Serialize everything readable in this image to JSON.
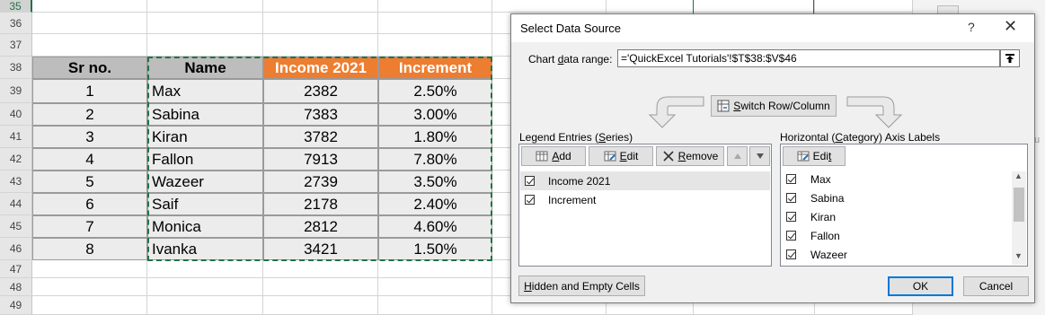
{
  "sheet": {
    "rows": [
      "35",
      "36",
      "37",
      "38",
      "39",
      "40",
      "41",
      "42",
      "43",
      "44",
      "45",
      "46",
      "47",
      "48",
      "49"
    ],
    "active_row": "35",
    "table": {
      "headers": [
        "Sr no.",
        "Name",
        "Income 2021",
        "Increment"
      ],
      "rows": [
        [
          "1",
          "Max",
          "2382",
          "2.50%"
        ],
        [
          "2",
          "Sabina",
          "7383",
          "3.00%"
        ],
        [
          "3",
          "Kiran",
          "3782",
          "1.80%"
        ],
        [
          "4",
          "Fallon",
          "7913",
          "7.80%"
        ],
        [
          "5",
          "Wazeer",
          "2739",
          "3.50%"
        ],
        [
          "6",
          "Saif",
          "2178",
          "2.40%"
        ],
        [
          "7",
          "Monica",
          "2812",
          "4.60%"
        ],
        [
          "8",
          "Ivanka",
          "3421",
          "1.50%"
        ]
      ]
    },
    "colors": {
      "header_grey": "#bdbdbd",
      "header_orange": "#ed7d31",
      "marquee": "#217346"
    }
  },
  "dialog": {
    "title": "Select Data Source",
    "help_icon": "?",
    "close_icon": "✕",
    "range_label_pre": "Chart ",
    "range_label_u": "d",
    "range_label_post": "ata range:",
    "range_value": "='QuickExcel Tutorials'!$T$38:$V$46",
    "switch_u": "S",
    "switch_rest": "witch Row/Column",
    "legend_title_pre": "Legend Entries (",
    "legend_title_u": "S",
    "legend_title_post": "eries)",
    "add_u": "A",
    "add_rest": "dd",
    "edit_u": "E",
    "edit_rest": "dit",
    "remove_u": "R",
    "remove_rest": "emove",
    "series": [
      "Income 2021",
      "Increment"
    ],
    "axis_title_pre": "Horizontal (",
    "axis_title_u": "C",
    "axis_title_post": "ategory) Axis Labels",
    "axis_edit_pre": "Edi",
    "axis_edit_u": "t",
    "axis_labels": [
      "Max",
      "Sabina",
      "Kiran",
      "Fallon",
      "Wazeer"
    ],
    "hidden_u": "H",
    "hidden_rest": "idden and Empty Cells",
    "ok_label": "OK",
    "cancel_label": "Cancel"
  }
}
